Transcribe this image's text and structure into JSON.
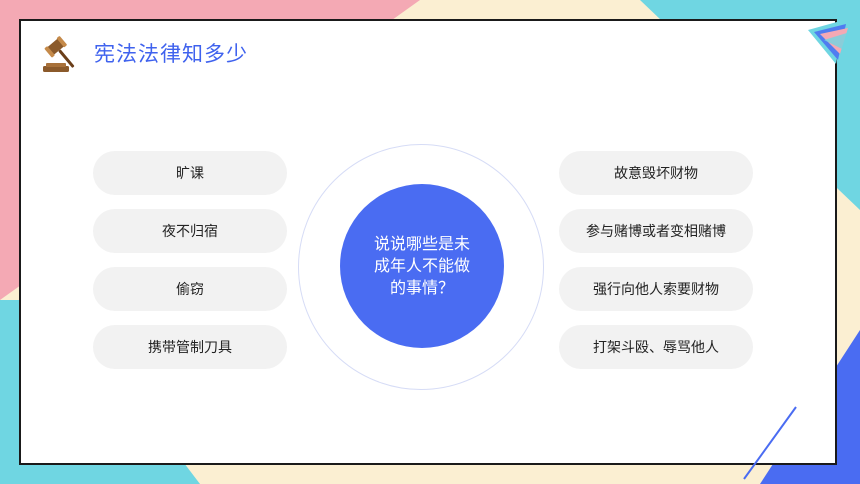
{
  "header": {
    "title": "宪法法律知多少",
    "icon": "gavel-icon"
  },
  "left_items": [
    {
      "label": "旷课"
    },
    {
      "label": "夜不归宿"
    },
    {
      "label": "偷窃"
    },
    {
      "label": "携带管制刀具"
    }
  ],
  "right_items": [
    {
      "label": "故意毁坏财物"
    },
    {
      "label": "参与赌博或者变相赌博"
    },
    {
      "label": "强行向他人索要财物"
    },
    {
      "label": "打架斗殴、辱骂他人"
    }
  ],
  "center": {
    "question": "说说哪些是未成年人不能做的事情？"
  },
  "colors": {
    "accent": "#4a6cf2",
    "pink": "#f4a9b4",
    "cyan": "#6fd6e2",
    "cream": "#fbefd2",
    "pill_bg": "#f2f2f2"
  }
}
